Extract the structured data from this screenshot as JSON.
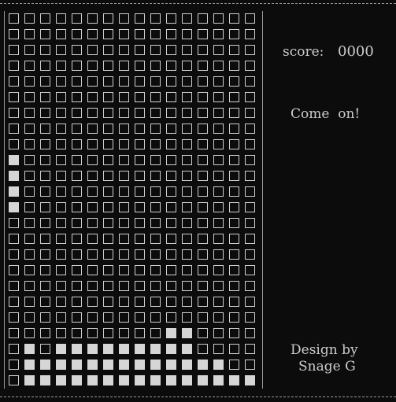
{
  "score": {
    "label": "score:",
    "value": "0000"
  },
  "message": "Come  on!",
  "credits": {
    "line1": "Design by",
    "line2": "Snage G"
  },
  "board": {
    "cols": 16,
    "rows": 24,
    "filled_cells": [
      [
        9,
        0
      ],
      [
        10,
        0
      ],
      [
        11,
        0
      ],
      [
        12,
        0
      ],
      [
        20,
        10
      ],
      [
        20,
        11
      ],
      [
        21,
        1
      ],
      [
        21,
        3
      ],
      [
        21,
        4
      ],
      [
        21,
        5
      ],
      [
        21,
        6
      ],
      [
        21,
        7
      ],
      [
        21,
        8
      ],
      [
        21,
        9
      ],
      [
        21,
        10
      ],
      [
        21,
        11
      ],
      [
        22,
        1
      ],
      [
        22,
        2
      ],
      [
        22,
        3
      ],
      [
        22,
        4
      ],
      [
        22,
        5
      ],
      [
        22,
        6
      ],
      [
        22,
        7
      ],
      [
        22,
        8
      ],
      [
        22,
        9
      ],
      [
        22,
        10
      ],
      [
        22,
        11
      ],
      [
        22,
        12
      ],
      [
        22,
        13
      ],
      [
        23,
        1
      ],
      [
        23,
        2
      ],
      [
        23,
        3
      ],
      [
        23,
        4
      ],
      [
        23,
        5
      ],
      [
        23,
        6
      ],
      [
        23,
        7
      ],
      [
        23,
        8
      ],
      [
        23,
        9
      ],
      [
        23,
        10
      ],
      [
        23,
        11
      ],
      [
        23,
        12
      ],
      [
        23,
        13
      ],
      [
        23,
        14
      ],
      [
        23,
        15
      ]
    ]
  },
  "colors": {
    "background": "#0c0c0c",
    "text": "#cccccc",
    "cell_outline": "#cfcfcf",
    "cell_filled": "#d6d6d6"
  }
}
